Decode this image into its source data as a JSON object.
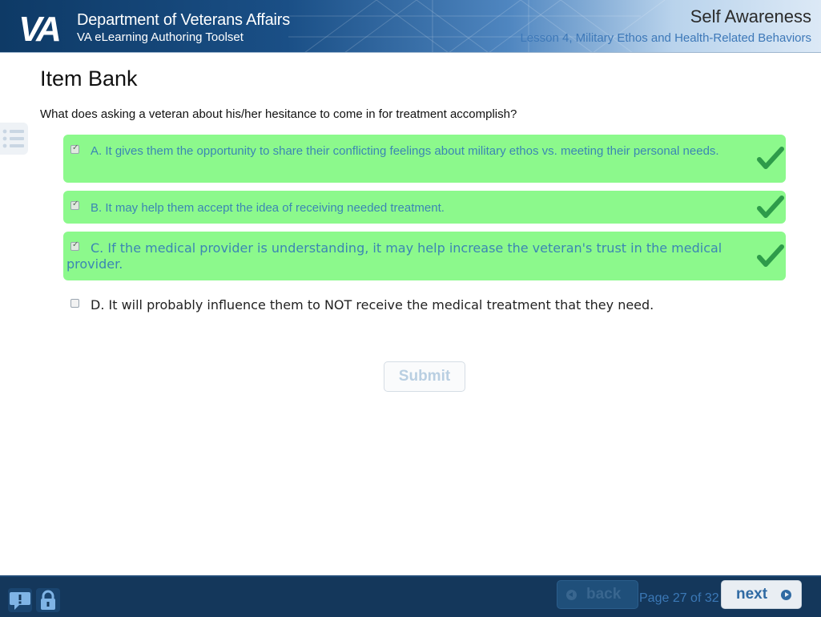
{
  "header": {
    "org_title": "Department of Veterans Affairs",
    "org_subtitle": "VA eLearning Authoring Toolset",
    "course_title": "Self Awareness",
    "lesson_title": "Lesson 4, Military Ethos and Health-Related Behaviors",
    "logo_text": "VA"
  },
  "page": {
    "title": "Item Bank",
    "question": "What does asking a veteran about his/her hesitance to come in for treatment accomplish?"
  },
  "choices": [
    {
      "text": "A. It gives them the opportunity to share their conflicting feelings about military ethos vs. meeting their personal needs.",
      "checked": true,
      "correct": true
    },
    {
      "text": "B. It may help them accept the idea of receiving needed treatment.",
      "checked": true,
      "correct": true
    },
    {
      "text": "C. If the medical provider is understanding, it may help increase the veteran's trust in the medical provider.",
      "checked": true,
      "correct": true
    },
    {
      "text": "D. It will probably influence them to NOT receive the medical treatment that they need.",
      "checked": false,
      "correct": false
    }
  ],
  "submit_label": "Submit",
  "footer": {
    "back_label": "back",
    "next_label": "next",
    "page_info": "Page 27 of 32",
    "help_icon": "help-icon",
    "lock_icon": "lock-icon"
  },
  "colors": {
    "header_dark": "#0e3a66",
    "correct_bg": "#8cf98c",
    "check_green": "#2e9b4a",
    "footer_bg": "#14375b",
    "link_blue": "#3d78b8"
  }
}
